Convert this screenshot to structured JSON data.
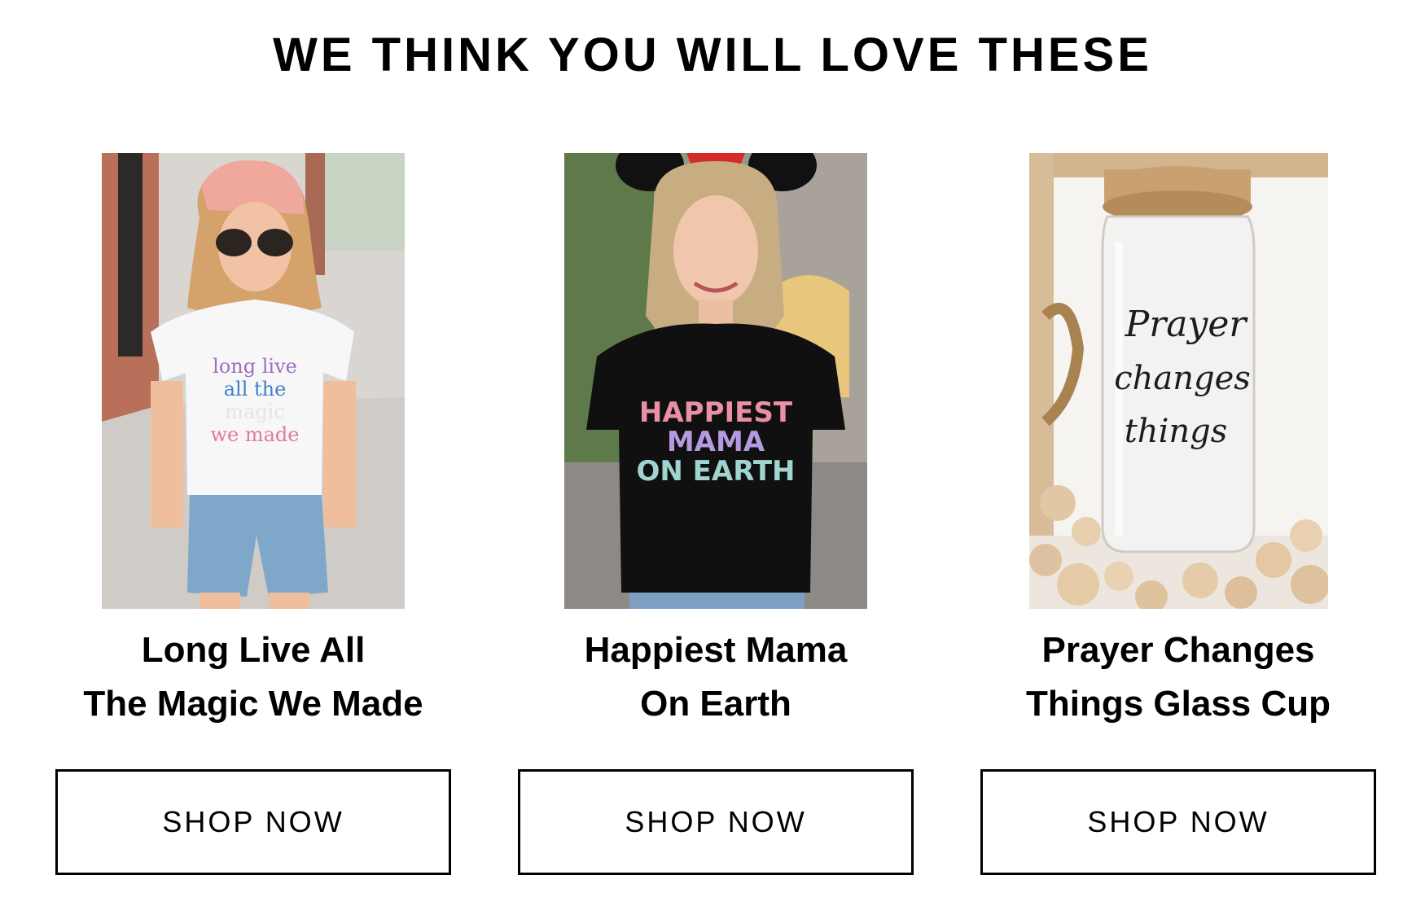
{
  "section": {
    "title": "WE THINK YOU WILL LOVE THESE"
  },
  "products": [
    {
      "name_line1": "Long Live All",
      "name_line2": "The Magic We Made",
      "button_label": "SHOP NOW",
      "shirt_text": [
        "long live",
        "all the",
        "magic",
        "we made"
      ]
    },
    {
      "name_line1": "Happiest Mama",
      "name_line2": "On Earth",
      "button_label": "SHOP NOW",
      "shirt_text": [
        "HAPPIEST",
        "MAMA",
        "ON EARTH"
      ]
    },
    {
      "name_line1": "Prayer Changes",
      "name_line2": "Things Glass Cup",
      "button_label": "SHOP NOW",
      "cup_text": [
        "Prayer",
        "changes",
        "things"
      ]
    }
  ],
  "colors": {
    "text": "#000000",
    "background": "#ffffff",
    "button_border": "#000000"
  }
}
